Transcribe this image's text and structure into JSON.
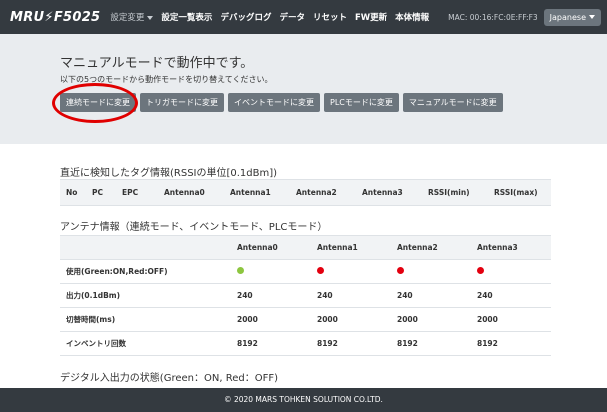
{
  "navbar": {
    "brand": "MRU⚡F5025",
    "items": [
      "設定変更",
      "設定一覧表示",
      "デバッグログ",
      "データ",
      "リセット",
      "FW更新",
      "本体情報"
    ],
    "mac": "MAC: 00:16:FC:0E:FF:F3",
    "language": "Japanese"
  },
  "jumbotron": {
    "title": "マニュアルモードで動作中です。",
    "subtitle": "以下の5つのモードから動作モードを切り替えてください。",
    "buttons": [
      "連続モードに変更",
      "トリガモードに変更",
      "イベントモードに変更",
      "PLCモードに変更",
      "マニュアルモードに変更"
    ]
  },
  "tag_section": {
    "title": "直近に検知したタグ情報(RSSIの単位[0.1dBm])",
    "headers": [
      "No",
      "PC",
      "EPC",
      "Antenna0",
      "Antenna1",
      "Antenna2",
      "Antenna3",
      "RSSI(min)",
      "RSSI(max)"
    ]
  },
  "antenna_section": {
    "title": "アンテナ情報（連続モード、イベントモード、PLCモード）",
    "headers": [
      "",
      "Antenna0",
      "Antenna1",
      "Antenna2",
      "Antenna3"
    ],
    "rows": [
      {
        "label": "使用(Green:ON,Red:OFF)",
        "status": [
          "#8dc63f",
          "#e3000f",
          "#e3000f",
          "#e3000f"
        ]
      },
      {
        "label": "出力(0.1dBm)",
        "values": [
          "240",
          "240",
          "240",
          "240"
        ]
      },
      {
        "label": "切替時間(ms)",
        "values": [
          "2000",
          "2000",
          "2000",
          "2000"
        ]
      },
      {
        "label": "インベントリ回数",
        "values": [
          "8192",
          "8192",
          "8192",
          "8192"
        ]
      }
    ]
  },
  "io_section": {
    "title": "デジタル入出力の状態(Green：ON, Red：OFF)"
  },
  "footer": {
    "text": "© 2020 MARS TOHKEN SOLUTION CO.LTD."
  }
}
